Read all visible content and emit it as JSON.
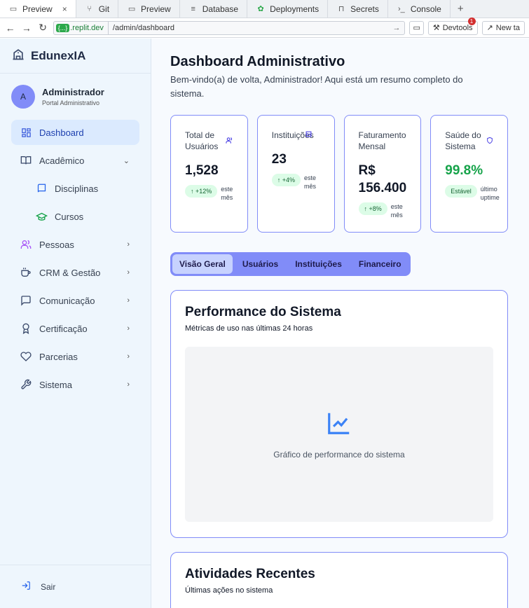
{
  "browser": {
    "tabs": [
      {
        "label": "Preview",
        "icon": "monitor-icon",
        "active": true
      },
      {
        "label": "Git",
        "icon": "git-icon"
      },
      {
        "label": "Preview",
        "icon": "monitor-icon"
      },
      {
        "label": "Database",
        "icon": "database-icon"
      },
      {
        "label": "Deployments",
        "icon": "deploy-icon"
      },
      {
        "label": "Secrets",
        "icon": "lock-icon"
      },
      {
        "label": "Console",
        "icon": "terminal-icon"
      }
    ],
    "close_glyph": "×",
    "new_tab_glyph": "+",
    "url_domain": ".replit.dev",
    "url_domain_pill": "{...}",
    "url_path": "/admin/dashboard",
    "devtools_label": "Devtools",
    "devtools_badge": "1",
    "new_tab_label": "New ta"
  },
  "sidebar": {
    "brand": "EdunexIA",
    "user_initial": "A",
    "user_name": "Administrador",
    "user_role": "Portal Administrativo",
    "items": [
      {
        "label": "Dashboard",
        "icon": "grid-icon",
        "active": true
      },
      {
        "label": "Acadêmico",
        "icon": "book-open-icon",
        "chevron": "⌄"
      },
      {
        "label": "Disciplinas",
        "icon": "book-icon",
        "sub": true
      },
      {
        "label": "Cursos",
        "icon": "graduation-cap-icon",
        "sub": true
      },
      {
        "label": "Pessoas",
        "icon": "users-icon",
        "chevron": "›"
      },
      {
        "label": "CRM & Gestão",
        "icon": "coffee-icon",
        "chevron": "›"
      },
      {
        "label": "Comunicação",
        "icon": "message-icon",
        "chevron": "›"
      },
      {
        "label": "Certificação",
        "icon": "award-icon",
        "chevron": "›"
      },
      {
        "label": "Parcerias",
        "icon": "heart-icon",
        "chevron": "›"
      },
      {
        "label": "Sistema",
        "icon": "wrench-icon",
        "chevron": "›"
      }
    ],
    "logout": "Sair"
  },
  "main": {
    "title": "Dashboard Administrativo",
    "subtitle": "Bem-vindo(a) de volta, Administrador! Aqui está um resumo completo do sistema.",
    "stats": [
      {
        "label": "Total de Usuários",
        "value": "1,528",
        "trend": "↑ +12%",
        "note": "este mês",
        "icon": "users-icon"
      },
      {
        "label": "Instituições",
        "value": "23",
        "trend": "↑ +4%",
        "note": "este mês",
        "icon": "building-icon"
      },
      {
        "label": "Faturamento Mensal",
        "value": "R$ 156.400",
        "trend": "↑ +8%",
        "note": "este mês",
        "icon": ""
      },
      {
        "label": "Saúde do Sistema",
        "value": "99.8%",
        "trend": "Estável",
        "note": "último uptime",
        "icon": "shield-icon"
      }
    ],
    "tabs": [
      "Visão Geral",
      "Usuários",
      "Instituições",
      "Financeiro"
    ],
    "performance": {
      "title": "Performance do Sistema",
      "subtitle": "Métricas de uso nas últimas 24 horas",
      "placeholder": "Gráfico de performance do sistema",
      "icon": "line-chart-icon"
    },
    "activity": {
      "title": "Atividades Recentes",
      "subtitle": "Últimas ações no sistema"
    }
  },
  "colors": {
    "accent": "#818cf8",
    "success": "#16a34a",
    "sidebar_bg": "#eef6fd"
  }
}
